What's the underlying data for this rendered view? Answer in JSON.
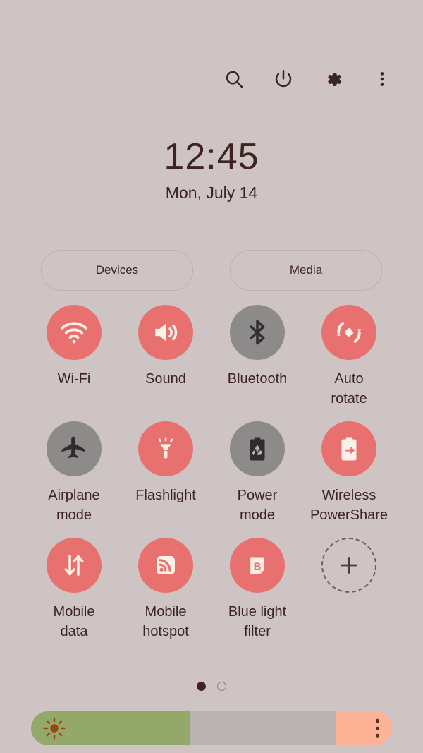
{
  "theme": {
    "background": "#cdc4c3",
    "text": "#3d2322",
    "active_tile": "#e8716f",
    "inactive_tile": "#8d8a8a",
    "icon_light": "#fdf0e6",
    "slider_track": "#b9b2b1",
    "slider_fill": "#94a869",
    "slider_right": "#fcb396"
  },
  "topbar": {
    "icons": [
      {
        "name": "search-icon",
        "label": "Search"
      },
      {
        "name": "power-icon",
        "label": "Power off"
      },
      {
        "name": "gear-icon",
        "label": "Settings"
      },
      {
        "name": "more-vertical-icon",
        "label": "More options"
      }
    ]
  },
  "clock": {
    "time": "12:45",
    "date": "Mon, July 14"
  },
  "pills": [
    {
      "label": "Devices"
    },
    {
      "label": "Media"
    }
  ],
  "tiles": [
    {
      "label": "Wi-Fi",
      "icon": "wifi-icon",
      "state": "on"
    },
    {
      "label": "Sound",
      "icon": "sound-icon",
      "state": "on"
    },
    {
      "label": "Bluetooth",
      "icon": "bluetooth-icon",
      "state": "off"
    },
    {
      "label": "Auto\nrotate",
      "icon": "auto-rotate-icon",
      "state": "on"
    },
    {
      "label": "Airplane\nmode",
      "icon": "airplane-icon",
      "state": "off"
    },
    {
      "label": "Flashlight",
      "icon": "flashlight-icon",
      "state": "on"
    },
    {
      "label": "Power\nmode",
      "icon": "power-mode-icon",
      "state": "off"
    },
    {
      "label": "Wireless\nPowerShare",
      "icon": "wireless-powershare-icon",
      "state": "on"
    },
    {
      "label": "Mobile\ndata",
      "icon": "mobile-data-icon",
      "state": "on"
    },
    {
      "label": "Mobile\nhotspot",
      "icon": "mobile-hotspot-icon",
      "state": "on"
    },
    {
      "label": "Blue light\nfilter",
      "icon": "blue-light-filter-icon",
      "state": "on"
    },
    {
      "label": "",
      "icon": "plus-icon",
      "state": "add"
    }
  ],
  "page_indicator": {
    "count": 2,
    "active_index": 0
  },
  "brightness": {
    "icon": "brightness-sun-icon",
    "value_percent": 44,
    "menu_icon": "more-vertical-icon"
  }
}
